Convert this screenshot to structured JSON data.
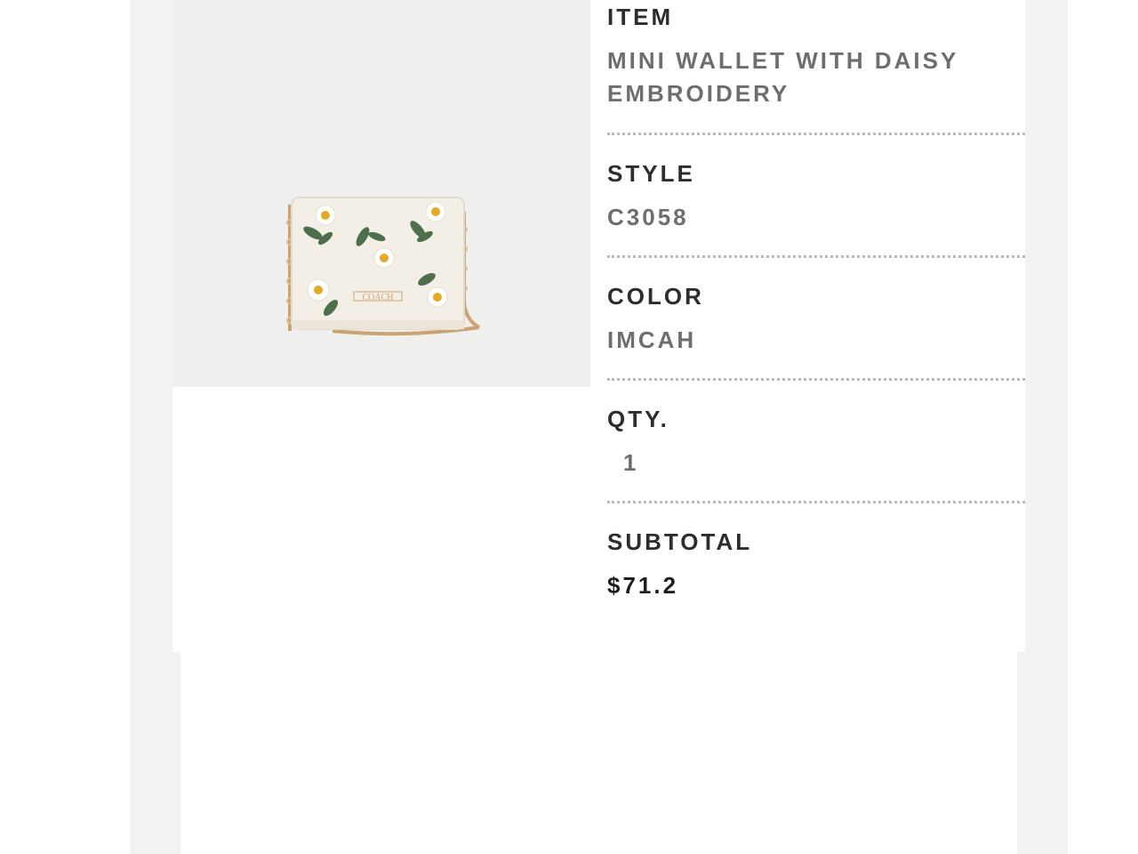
{
  "product": {
    "image_alt": "Mini Wallet With Daisy Embroidery",
    "image_icon": "wallet-product-image",
    "logo_text": "COACH"
  },
  "details": {
    "item": {
      "label": "ITEM",
      "value": "MINI WALLET WITH DAISY EMBROIDERY"
    },
    "style": {
      "label": "STYLE",
      "value": "C3058"
    },
    "color": {
      "label": "COLOR",
      "value": "IMCAH"
    },
    "qty": {
      "label": "QTY.",
      "value": "1"
    },
    "subtotal": {
      "label": "SUBTOTAL",
      "value": "$71.2"
    }
  },
  "colors": {
    "band": "#f2f2f0",
    "label": "#2d2d2d",
    "value": "#6e6e6e",
    "divider": "#b9b9b9"
  }
}
